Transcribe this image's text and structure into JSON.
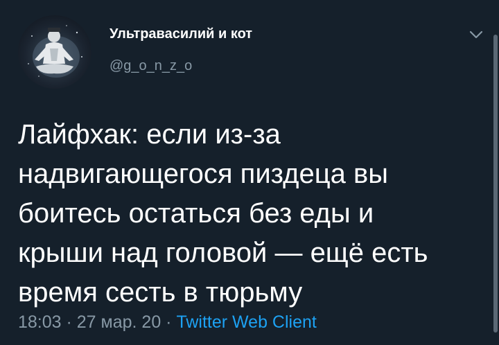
{
  "tweet": {
    "author": {
      "display_name": "Ультравасилий и кот",
      "username": "@g_o_n_z_o",
      "avatar_icon": "meditating-figure-avatar"
    },
    "menu_icon": "chevron-down-icon",
    "text": "Лайфхак: если из-за\nнадвигающегося пиздеца вы\nбоитесь остаться без еды и\nкрыши над головой — ещё есть\nвремя сесть в тюрьму",
    "time": "18:03",
    "separator": " · ",
    "date": "27 мар. 20",
    "source": "Twitter Web Client"
  },
  "colors": {
    "background": "#15202b",
    "text": "#ffffff",
    "secondary": "#8899a6",
    "link": "#1da1f2"
  }
}
